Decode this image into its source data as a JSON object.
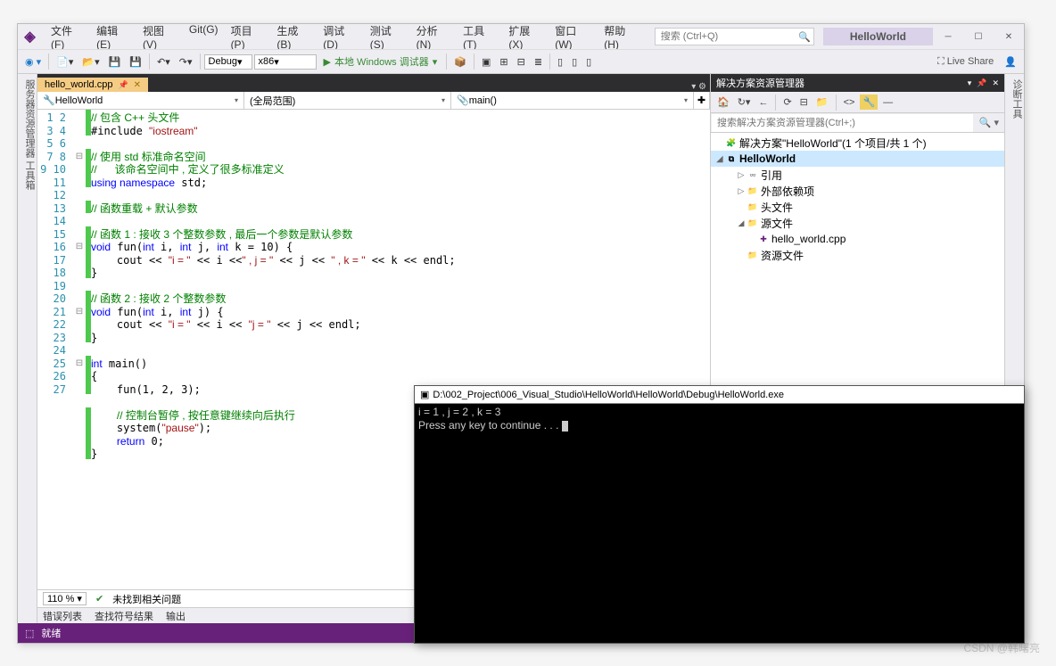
{
  "menu": [
    "文件(F)",
    "编辑(E)",
    "视图(V)",
    "Git(G)",
    "项目(P)",
    "生成(B)",
    "调试(D)",
    "测试(S)",
    "分析(N)",
    "工具(T)",
    "扩展(X)",
    "窗口(W)",
    "帮助(H)"
  ],
  "search_placeholder": "搜索 (Ctrl+Q)",
  "project_name": "HelloWorld",
  "liveshare": "Live Share",
  "toolbar": {
    "config": "Debug",
    "platform": "x86",
    "start": "本地 Windows 调试器"
  },
  "left_rail": "服务器资源管理器   工具箱",
  "right_rail": "诊断工具",
  "tab": {
    "name": "hello_world.cpp"
  },
  "nav": {
    "project": "HelloWorld",
    "scope": "(全局范围)",
    "member": "main()"
  },
  "lines": 27,
  "code_rows": [
    {
      "fold": "",
      "mark": "g",
      "html": "<span class='c'>// 包含 C++ 头文件</span>"
    },
    {
      "fold": "",
      "mark": "g",
      "html": "#include <span class='s'>\"iostream\"</span>"
    },
    {
      "fold": "",
      "mark": "",
      "html": ""
    },
    {
      "fold": "⊟",
      "mark": "g",
      "html": "<span class='c'>// 使用 std 标准命名空间</span>"
    },
    {
      "fold": "",
      "mark": "g",
      "html": "<span class='c'>//      该命名空间中 , 定义了很多标准定义</span>"
    },
    {
      "fold": "",
      "mark": "g",
      "html": "<span class='k'>using namespace</span> std;"
    },
    {
      "fold": "",
      "mark": "",
      "html": ""
    },
    {
      "fold": "",
      "mark": "g",
      "html": "<span class='c'>// 函数重载 + 默认参数</span>"
    },
    {
      "fold": "",
      "mark": "",
      "html": ""
    },
    {
      "fold": "",
      "mark": "g",
      "html": "<span class='c'>// 函数 1 : 接收 3 个整数参数 , 最后一个参数是默认参数</span>"
    },
    {
      "fold": "⊟",
      "mark": "g",
      "html": "<span class='k'>void</span> fun(<span class='k'>int</span> i, <span class='k'>int</span> j, <span class='k'>int</span> k = 10) {"
    },
    {
      "fold": "",
      "mark": "g",
      "html": "    cout &lt;&lt; <span class='s'>\"i = \"</span> &lt;&lt; i &lt;&lt;<span class='s'>\" , j = \"</span> &lt;&lt; j &lt;&lt; <span class='s'>\" , k = \"</span> &lt;&lt; k &lt;&lt; endl;"
    },
    {
      "fold": "",
      "mark": "g",
      "html": "}"
    },
    {
      "fold": "",
      "mark": "",
      "html": ""
    },
    {
      "fold": "",
      "mark": "g",
      "html": "<span class='c'>// 函数 2 : 接收 2 个整数参数</span>"
    },
    {
      "fold": "⊟",
      "mark": "g",
      "html": "<span class='k'>void</span> fun(<span class='k'>int</span> i, <span class='k'>int</span> j) {"
    },
    {
      "fold": "",
      "mark": "g",
      "html": "    cout &lt;&lt; <span class='s'>\"i = \"</span> &lt;&lt; i &lt;&lt; <span class='s'>\"j = \"</span> &lt;&lt; j &lt;&lt; endl;"
    },
    {
      "fold": "",
      "mark": "g",
      "html": "}"
    },
    {
      "fold": "",
      "mark": "",
      "html": ""
    },
    {
      "fold": "⊟",
      "mark": "g",
      "html": "<span class='k'>int</span> main()"
    },
    {
      "fold": "",
      "mark": "g",
      "html": "{"
    },
    {
      "fold": "",
      "mark": "g",
      "html": "    fun(1, 2, 3);"
    },
    {
      "fold": "",
      "mark": "",
      "html": ""
    },
    {
      "fold": "",
      "mark": "g",
      "html": "    <span class='c'>// 控制台暂停 , 按任意键继续向后执行</span>"
    },
    {
      "fold": "",
      "mark": "g",
      "html": "    system(<span class='s'>\"pause\"</span>);"
    },
    {
      "fold": "",
      "mark": "g",
      "html": "    <span class='k'>return</span> 0;"
    },
    {
      "fold": "",
      "mark": "g",
      "html": "}"
    }
  ],
  "zoom": "110 %",
  "issues": "未找到相关问题",
  "outwin_tabs": [
    "错误列表",
    "查找符号结果",
    "输出"
  ],
  "status": "就绪",
  "explorer": {
    "title": "解决方案资源管理器",
    "search_placeholder": "搜索解决方案资源管理器(Ctrl+;)",
    "solution": "解决方案\"HelloWorld\"(1 个项目/共 1 个)",
    "project": "HelloWorld",
    "nodes": {
      "refs": "引用",
      "ext": "外部依赖项",
      "hdr": "头文件",
      "src": "源文件",
      "srcfile": "hello_world.cpp",
      "res": "资源文件"
    }
  },
  "console": {
    "title": "D:\\002_Project\\006_Visual_Studio\\HelloWorld\\HelloWorld\\Debug\\HelloWorld.exe",
    "line1": "i = 1 , j = 2 , k = 3",
    "line2": "Press any key to continue . . . "
  },
  "watermark": "CSDN @韩曙亮"
}
